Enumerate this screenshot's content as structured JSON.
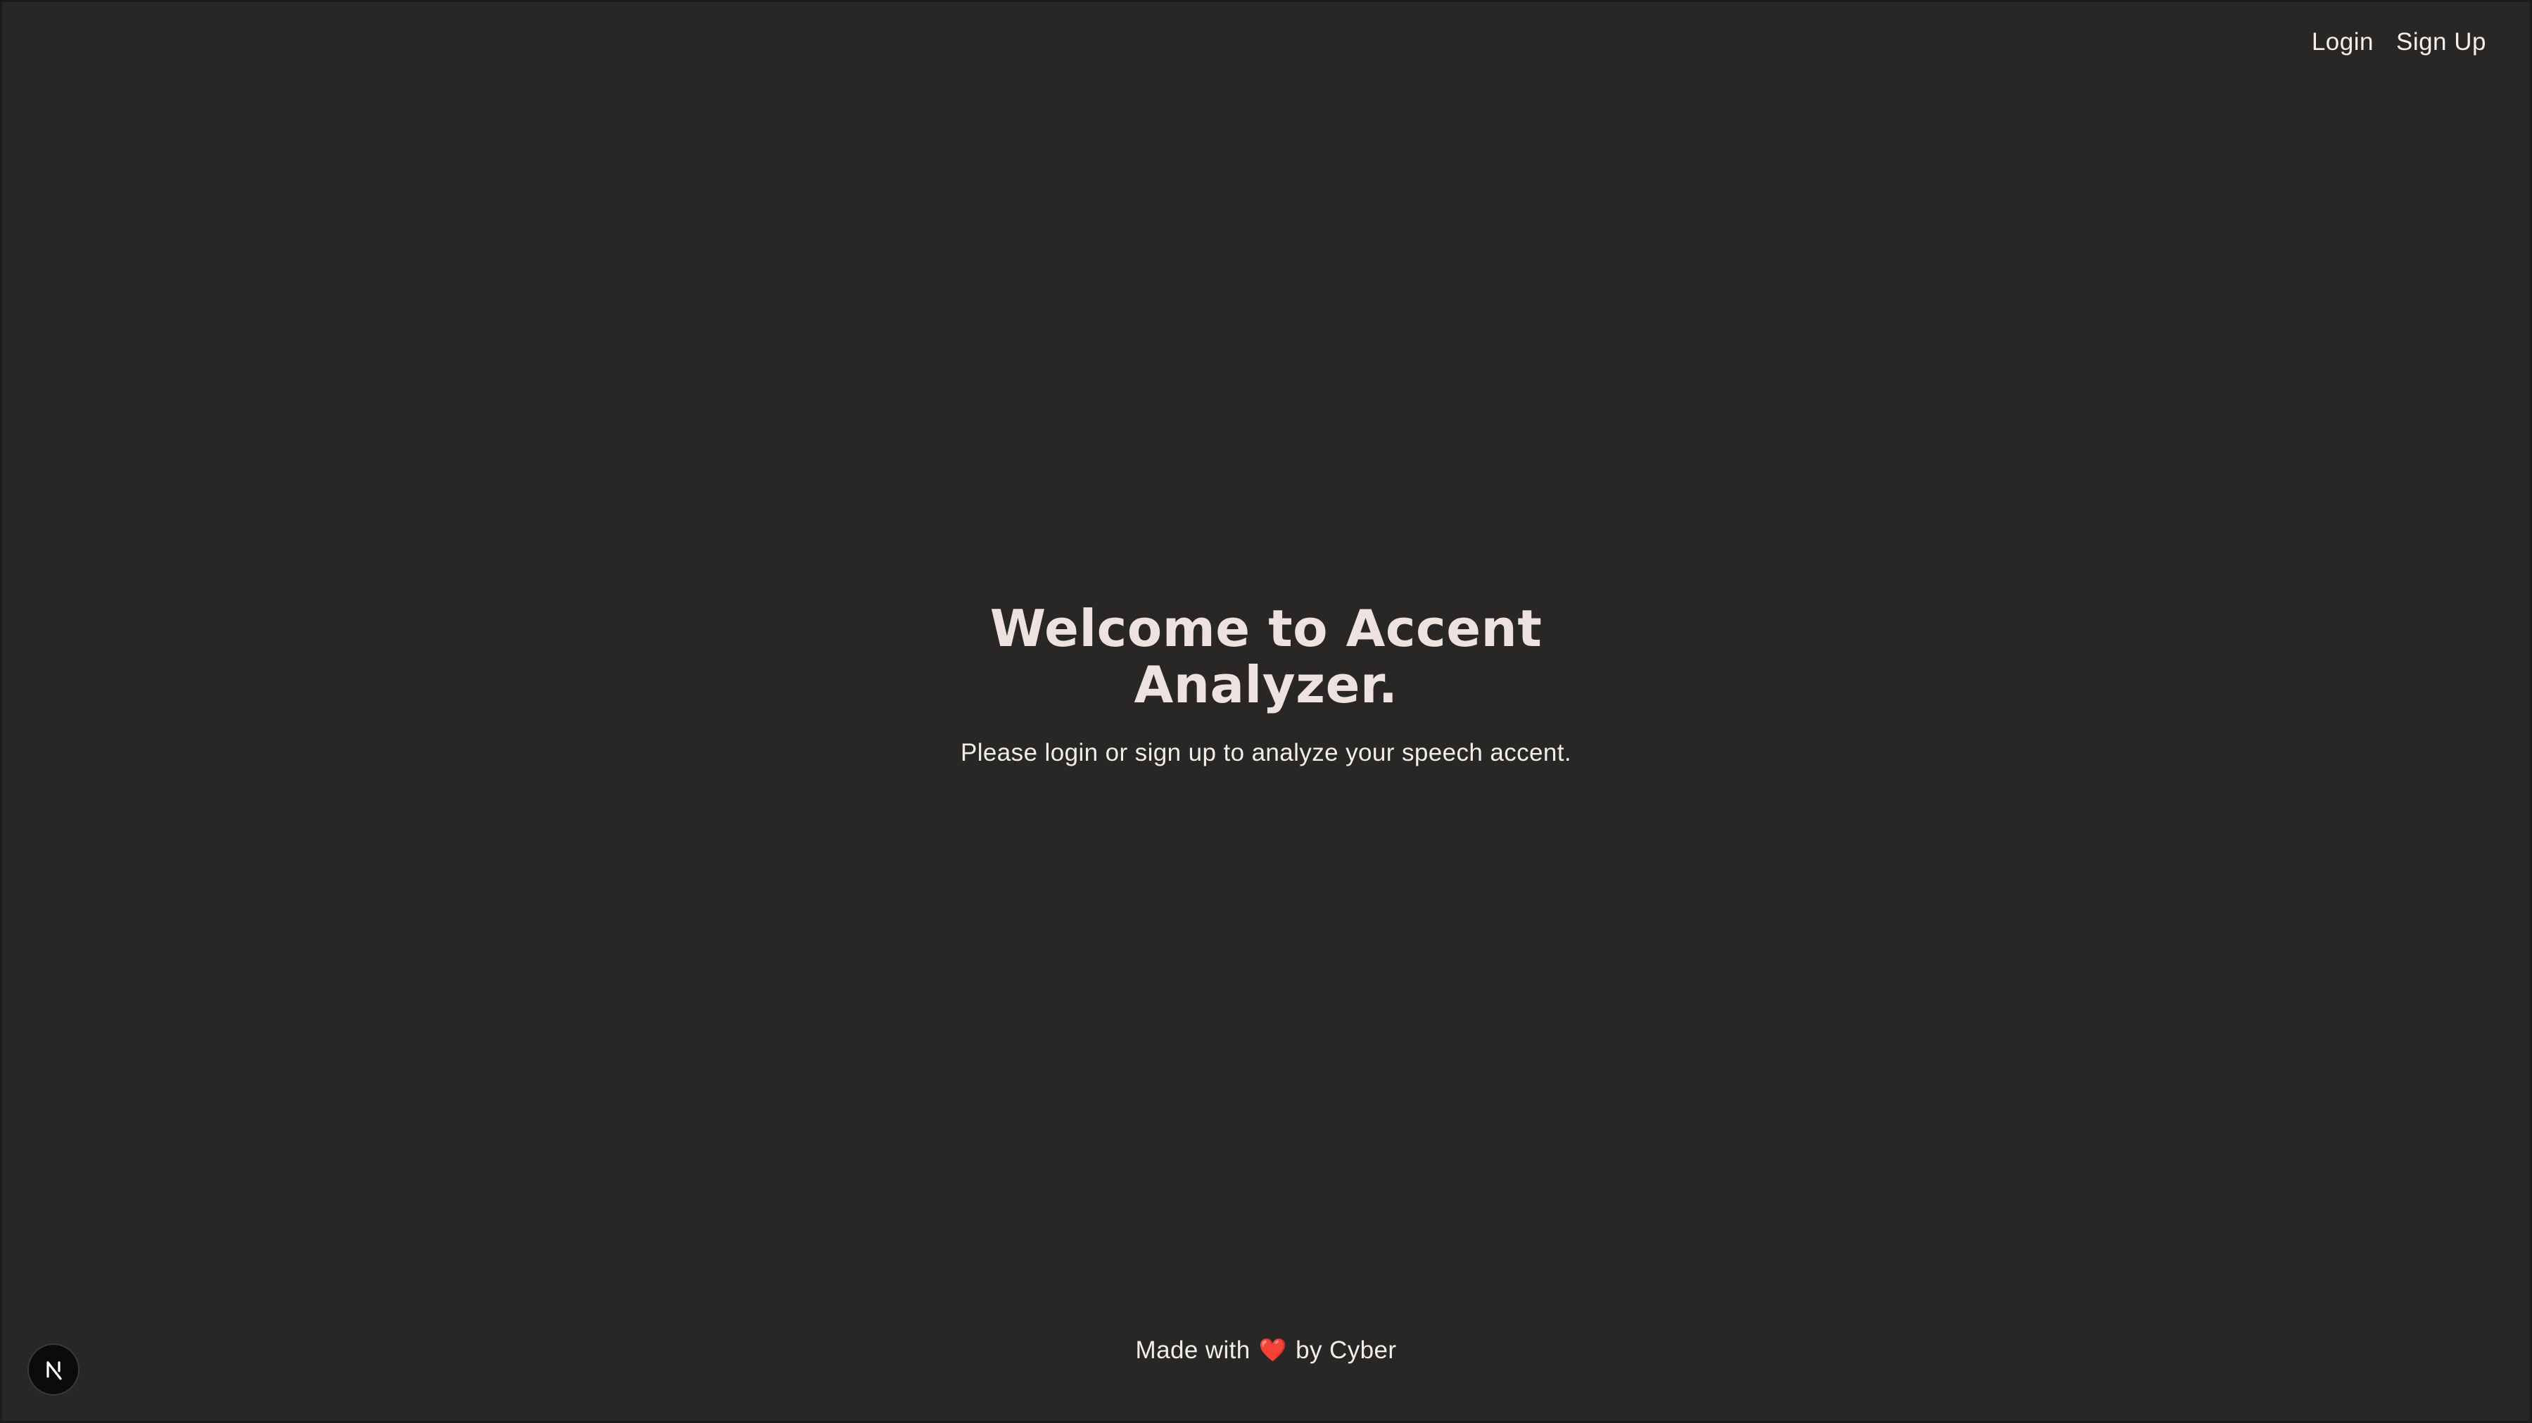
{
  "nav": {
    "login_label": "Login",
    "signup_label": "Sign Up"
  },
  "hero": {
    "title": "Welcome to Accent Analyzer.",
    "subtitle": "Please login or sign up to analyze your speech accent."
  },
  "footer": {
    "prefix": "Made with",
    "heart": "❤️",
    "suffix": "by Cyber"
  },
  "badge": {
    "letter": "N",
    "icon": "nextjs-icon"
  },
  "colors": {
    "background": "#282725",
    "text": "#f2ece8",
    "heart": "#e33b3b",
    "badge": "#0b0b0b"
  }
}
